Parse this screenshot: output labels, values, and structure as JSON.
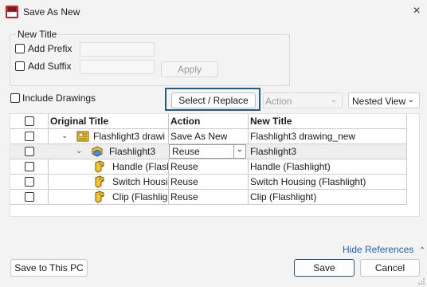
{
  "window": {
    "title": "Save As New",
    "close_glyph": "×"
  },
  "new_title": {
    "legend": "New Title",
    "add_prefix_label": "Add Prefix",
    "add_prefix_value": "",
    "add_suffix_label": "Add Suffix",
    "add_suffix_value": "",
    "apply_label": "Apply"
  },
  "include_drawings_label": "Include Drawings",
  "select_replace_label": "Select / Replace",
  "action_select": {
    "value": "Action",
    "disabled": true
  },
  "view_select": {
    "value": "Nested View"
  },
  "table": {
    "headers": {
      "original": "Original Title",
      "action": "Action",
      "new_title": "New Title"
    },
    "rows": [
      {
        "original": "Flashlight3 drawi",
        "action": "Save As New",
        "new_title": "Flashlight3 drawing_new",
        "level": 0,
        "icon": "drawing-icon"
      },
      {
        "original": "Flashlight3",
        "action": "Reuse",
        "new_title": "Flashlight3",
        "level": 1,
        "icon": "assembly-icon"
      },
      {
        "original": "Handle (Flash",
        "action": "Reuse",
        "new_title": "Handle (Flashlight)",
        "level": 2,
        "icon": "part-icon"
      },
      {
        "original": "Switch Housi",
        "action": "Reuse",
        "new_title": "Switch Housing (Flashlight)",
        "level": 2,
        "icon": "part-icon"
      },
      {
        "original": "Clip (Flashlig",
        "action": "Reuse",
        "new_title": "Clip (Flashlight)",
        "level": 2,
        "icon": "part-icon"
      }
    ]
  },
  "hide_references_label": "Hide References",
  "save_to_pc_label": "Save to This PC",
  "save_label": "Save",
  "cancel_label": "Cancel",
  "colors": {
    "accent": "#245a80",
    "link": "#1f5fae"
  }
}
